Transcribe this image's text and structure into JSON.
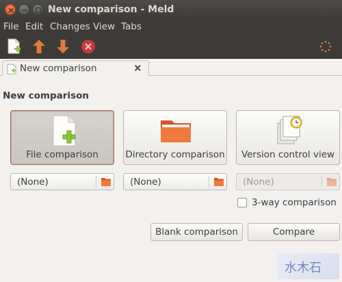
{
  "window": {
    "title": "New comparison - Meld"
  },
  "menubar": {
    "items": [
      "File",
      "Edit",
      "Changes",
      "View",
      "Tabs"
    ]
  },
  "toolbar": {
    "icons": [
      "new-document-icon",
      "arrow-up-icon",
      "arrow-down-icon",
      "stop-icon",
      "spinner-icon"
    ],
    "colors": {
      "arrow": "#e07b39",
      "stop": "#c43a3a"
    }
  },
  "tab": {
    "label": "New comparison",
    "close": "×"
  },
  "page": {
    "heading": "New comparison",
    "buttons": {
      "file": "File comparison",
      "directory": "Directory comparison",
      "version": "Version control view"
    },
    "choosers": {
      "file": "(None)",
      "directory": "(None)",
      "version": "(None)"
    },
    "threeway_label": "3-way comparison",
    "threeway_checked": false,
    "blank_button": "Blank comparison",
    "compare_button": "Compare"
  },
  "watermark": {
    "text": "水木石"
  }
}
